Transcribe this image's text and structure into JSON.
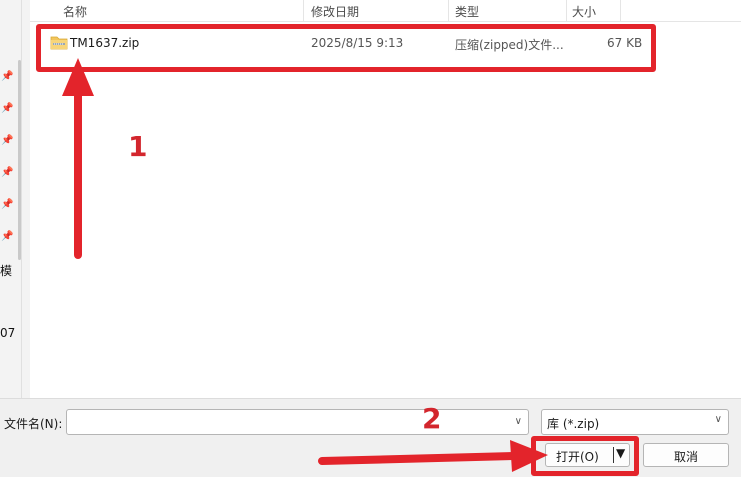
{
  "left_nav": {
    "partial_text_1": "模",
    "partial_text_2": "07"
  },
  "columns": {
    "name": "名称",
    "modified": "修改日期",
    "type": "类型",
    "size": "大小"
  },
  "files": [
    {
      "name": "TM1637.zip",
      "modified": "2025/8/15 9:13",
      "type": "压缩(zipped)文件...",
      "size": "67 KB",
      "icon": "zip-folder-icon"
    }
  ],
  "footer": {
    "filename_label": "文件名(N):",
    "filename_value": "",
    "filter_value": "库 (*.zip)",
    "open_label": "打开(O)",
    "cancel_label": "取消"
  },
  "annotations": {
    "step1": "1",
    "step2": "2",
    "color": "#e3242b"
  }
}
